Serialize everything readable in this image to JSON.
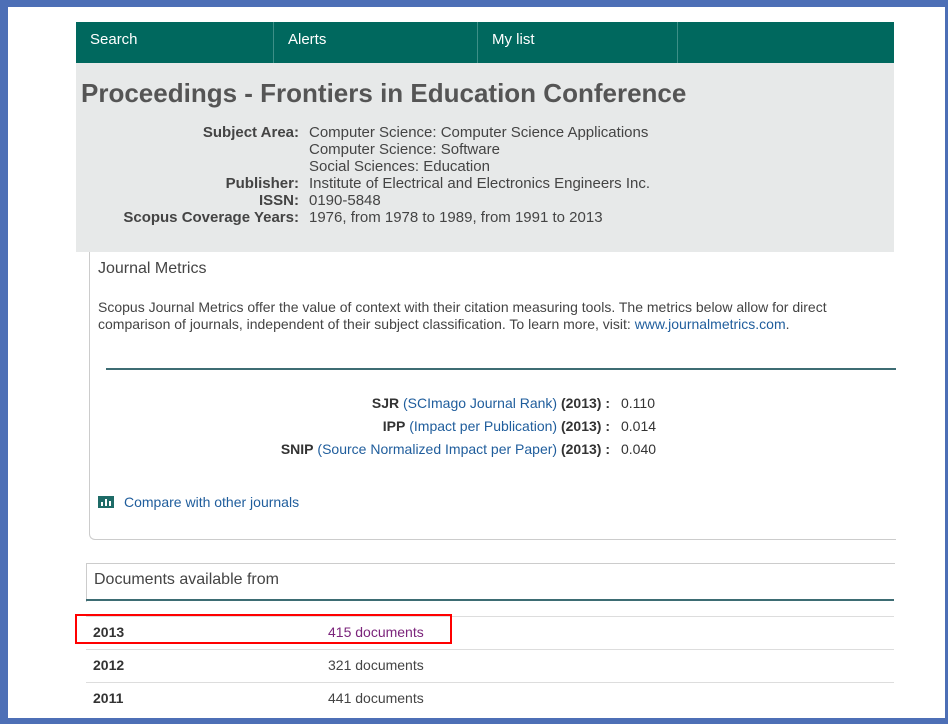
{
  "nav": {
    "items": [
      {
        "label": "Search"
      },
      {
        "label": "Alerts"
      },
      {
        "label": "My list"
      }
    ],
    "background": "#00685e"
  },
  "source": {
    "title": "Proceedings - Frontiers in Education Conference",
    "subject_area_label": "Subject Area:",
    "subject_areas": [
      "Computer Science: Computer Science Applications",
      "Computer Science: Software",
      "Social Sciences: Education"
    ],
    "publisher_label": "Publisher:",
    "publisher": "Institute of Electrical and Electronics Engineers Inc.",
    "issn_label": "ISSN:",
    "issn": "0190-5848",
    "coverage_label": "Scopus Coverage Years:",
    "coverage": "1976, from 1978 to 1989, from 1991 to 2013"
  },
  "metrics": {
    "title": "Journal Metrics",
    "description": "Scopus Journal Metrics offer the value of context with their citation measuring tools. The metrics below allow for direct comparison of journals, independent of their subject classification. To learn more, visit: ",
    "link_text": "www.journalmetrics.com",
    "link_suffix": ".",
    "rows": [
      {
        "abbr": "SJR",
        "name": "(SCImago Journal Rank)",
        "year": "(2013) :",
        "value": "0.110"
      },
      {
        "abbr": "IPP",
        "name": "(Impact per Publication)",
        "year": "(2013) :",
        "value": "0.014"
      },
      {
        "abbr": "SNIP",
        "name": "(Source Normalized Impact per Paper)",
        "year": "(2013) :",
        "value": "0.040"
      }
    ],
    "compare_label": "Compare with other journals"
  },
  "documents": {
    "title": "Documents available from",
    "rows": [
      {
        "year": "2013",
        "count": "415 documents"
      },
      {
        "year": "2012",
        "count": "321 documents"
      },
      {
        "year": "2011",
        "count": "441 documents"
      }
    ],
    "highlight_color": "#ff0000"
  }
}
